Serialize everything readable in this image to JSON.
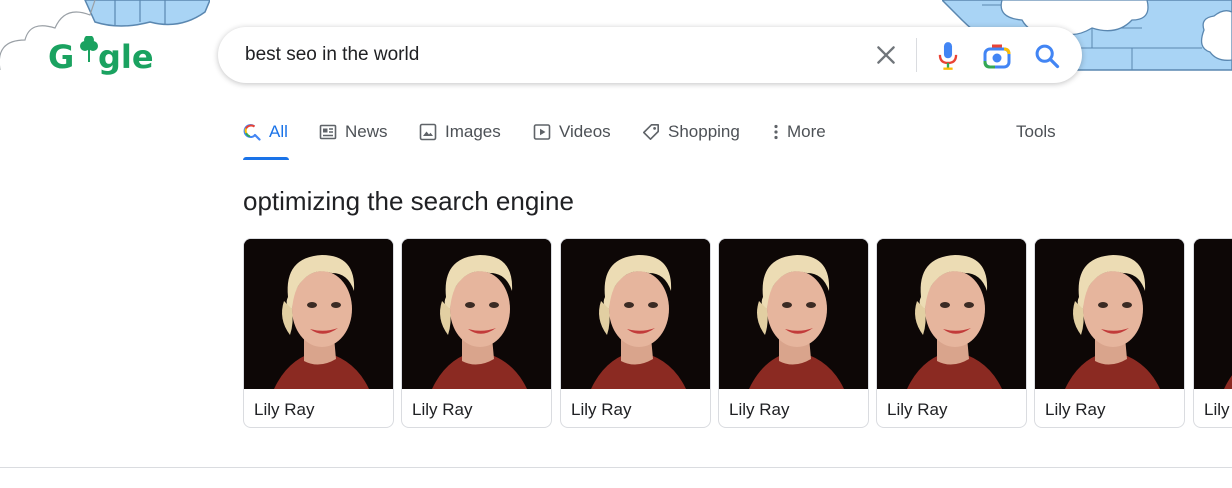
{
  "logo": {
    "text": "Google",
    "accent_color": "#1aa260"
  },
  "search": {
    "query": "best seo in the world",
    "clear_icon": "close-icon",
    "voice_icon": "mic-icon",
    "lens_icon": "camera-lens-icon",
    "submit_icon": "search-icon"
  },
  "tabs": [
    {
      "label": "All",
      "icon": "search-icon",
      "active": true
    },
    {
      "label": "News",
      "icon": "news-icon"
    },
    {
      "label": "Images",
      "icon": "image-icon"
    },
    {
      "label": "Videos",
      "icon": "video-icon"
    },
    {
      "label": "Shopping",
      "icon": "tag-icon"
    },
    {
      "label": "More",
      "icon": "more-vert-icon"
    }
  ],
  "tools_label": "Tools",
  "section": {
    "title": "optimizing the search engine",
    "cards": [
      {
        "name": "Lily Ray"
      },
      {
        "name": "Lily Ray"
      },
      {
        "name": "Lily Ray"
      },
      {
        "name": "Lily Ray"
      },
      {
        "name": "Lily Ray"
      },
      {
        "name": "Lily Ray"
      },
      {
        "name": "Lily"
      }
    ]
  },
  "colors": {
    "accent_blue": "#1a73e8",
    "doodle_sky": "#a9d4f5",
    "logo_green": "#1aa260"
  }
}
